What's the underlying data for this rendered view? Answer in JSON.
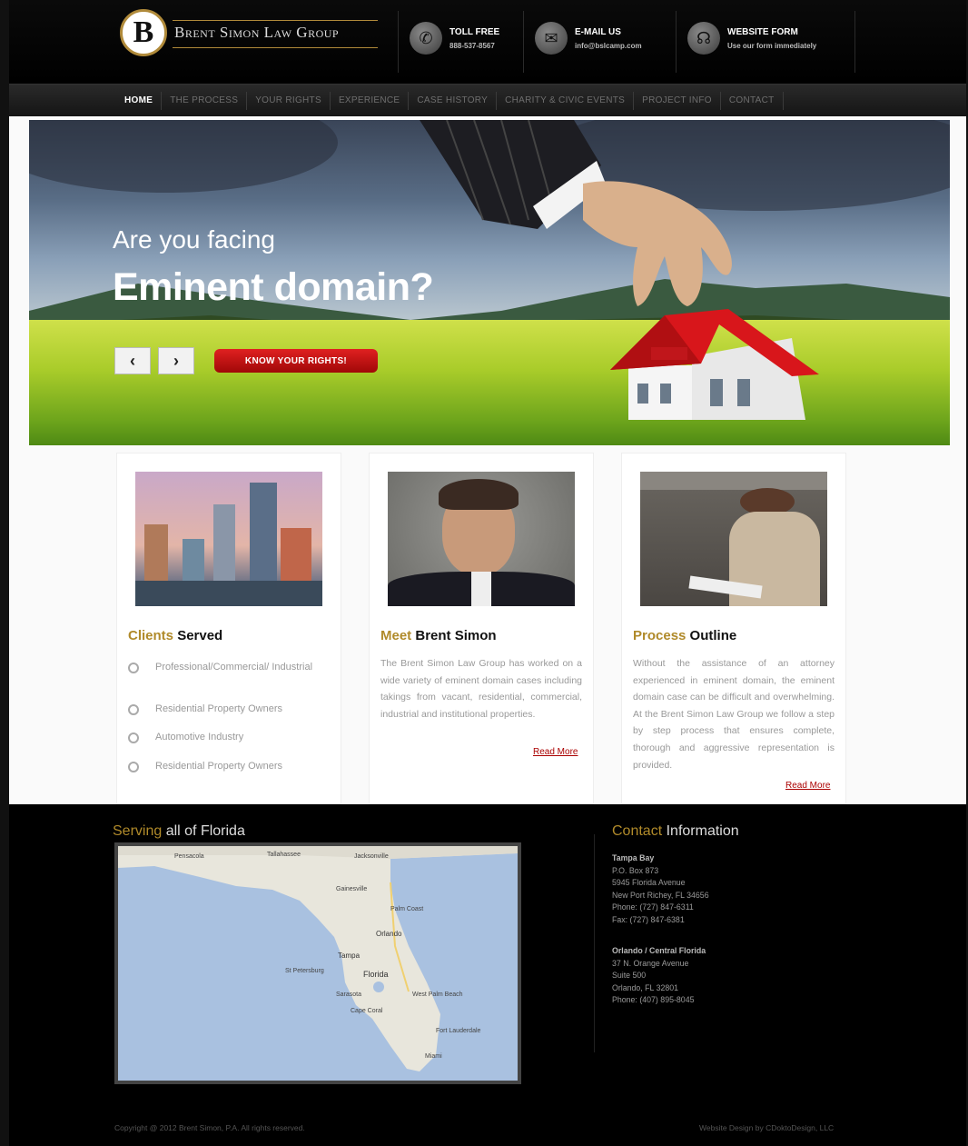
{
  "header": {
    "logo_initials": "B",
    "logo_text": "Brent Simon Law Group",
    "info": [
      {
        "label": "TOLL FREE",
        "value": "888-537-8567",
        "icon": "phone-icon"
      },
      {
        "label": "E-MAIL US",
        "value": "info@bslcamp.com",
        "icon": "mail-icon"
      },
      {
        "label": "WEBSITE FORM",
        "value": "Use our form immediately",
        "icon": "headset-icon"
      }
    ]
  },
  "nav": {
    "items": [
      "HOME",
      "THE PROCESS",
      "YOUR RIGHTS",
      "EXPERIENCE",
      "CASE HISTORY",
      "CHARITY & CIVIC EVENTS",
      "PROJECT INFO",
      "CONTACT"
    ]
  },
  "hero": {
    "subtitle": "Are you facing",
    "title": "Eminent domain?",
    "prev": "‹",
    "next": "›",
    "cta": "KNOW YOUR RIGHTS!"
  },
  "columns": {
    "clients": {
      "title_hl": "Clients",
      "title_rest": "Served",
      "items": [
        "Professional/Commercial/ Industrial",
        "Residential Property Owners",
        "Automotive Industry",
        "Residential Property Owners"
      ]
    },
    "meet": {
      "title_hl": "Meet",
      "title_rest": "Brent Simon",
      "text": "The Brent Simon Law Group has worked on a wide variety of eminent domain cases including takings from vacant, residential, commercial, industrial and institutional properties.",
      "readmore": "Read More"
    },
    "process": {
      "title_hl": "Process",
      "title_rest": "Outline",
      "text": "Without the assistance of an attorney experienced in eminent domain, the eminent domain case can be difficult and overwhelming. At the Brent Simon Law Group we follow a step by step process that ensures complete, thorough and aggressive representation is provided.",
      "readmore": "Read More"
    }
  },
  "footer": {
    "serving_hl": "Serving",
    "serving_rest": "all of Florida",
    "map_labels": [
      "Pensacola",
      "Tallahassee",
      "Jacksonville",
      "Gainesville",
      "Palm Coast",
      "Orlando",
      "Tampa",
      "St Petersburg",
      "Florida",
      "Sarasota",
      "Cape Coral",
      "West Palm Beach",
      "Fort Lauderdale",
      "Miami"
    ],
    "contact_hl": "Contact",
    "contact_rest": "Information",
    "offices": [
      {
        "name": "Tampa Bay",
        "lines": [
          "P.O. Box 873",
          "5945 Florida Avenue",
          "New Port Richey, FL 34656"
        ],
        "phone": "Phone: (727) 847-6311",
        "fax": "Fax: (727) 847-6381"
      },
      {
        "name": "Orlando / Central Florida",
        "lines": [
          "37 N. Orange Avenue",
          "Suite 500",
          "Orlando, FL 32801"
        ],
        "phone": "Phone: (407) 895-8045",
        "fax": ""
      }
    ],
    "copyright": "Copyright @ 2012 Brent Simon, P.A. All rights reserved.",
    "credit": "Website Design by CDoktoDesign, LLC"
  }
}
